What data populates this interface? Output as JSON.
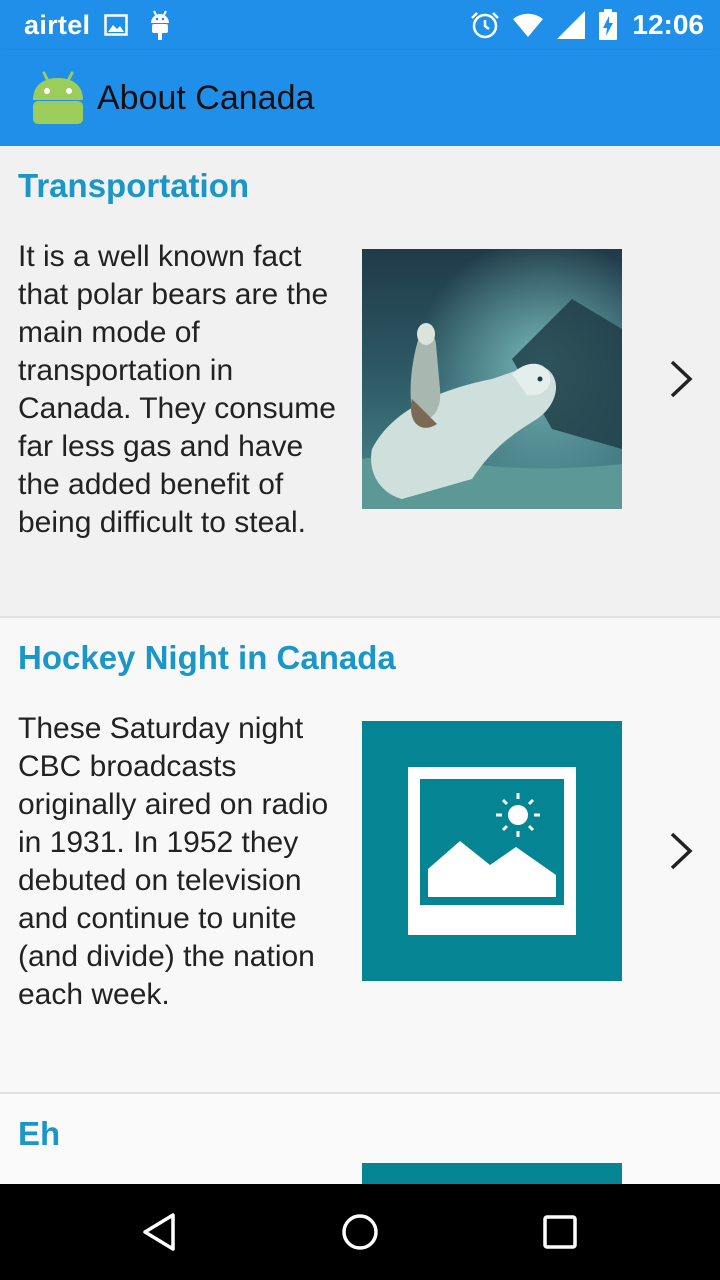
{
  "status_bar": {
    "carrier": "airtel",
    "time": "12:06",
    "left_icons": [
      "image-icon",
      "android-debug-icon"
    ],
    "right_icons": [
      "alarm-icon",
      "wifi-icon",
      "signal-icon",
      "battery-charging-icon"
    ]
  },
  "app_bar": {
    "title": "About Canada",
    "logo": "android-logo-icon",
    "color": "#1f8fea"
  },
  "items": [
    {
      "title": "Transportation",
      "body": "It is a well known fact that polar bears are the main mode of transportation in Canada. They consume far less gas and have the added benefit of being difficult to steal.",
      "image": "polar-bear-photo"
    },
    {
      "title": "Hockey Night in Canada",
      "body": "These Saturday night CBC broadcasts originally aired on radio in 1931. In 1952 they debuted on television and continue to unite (and divide) the nation each week.",
      "image": "image-placeholder-icon"
    },
    {
      "title": "Eh",
      "body": "",
      "image": "image-placeholder-icon"
    }
  ],
  "colors": {
    "title_color": "#1a96c8",
    "placeholder_bg": "#058594"
  },
  "nav_bar": {
    "buttons": [
      "back-triangle-icon",
      "home-circle-icon",
      "recents-square-icon"
    ]
  }
}
